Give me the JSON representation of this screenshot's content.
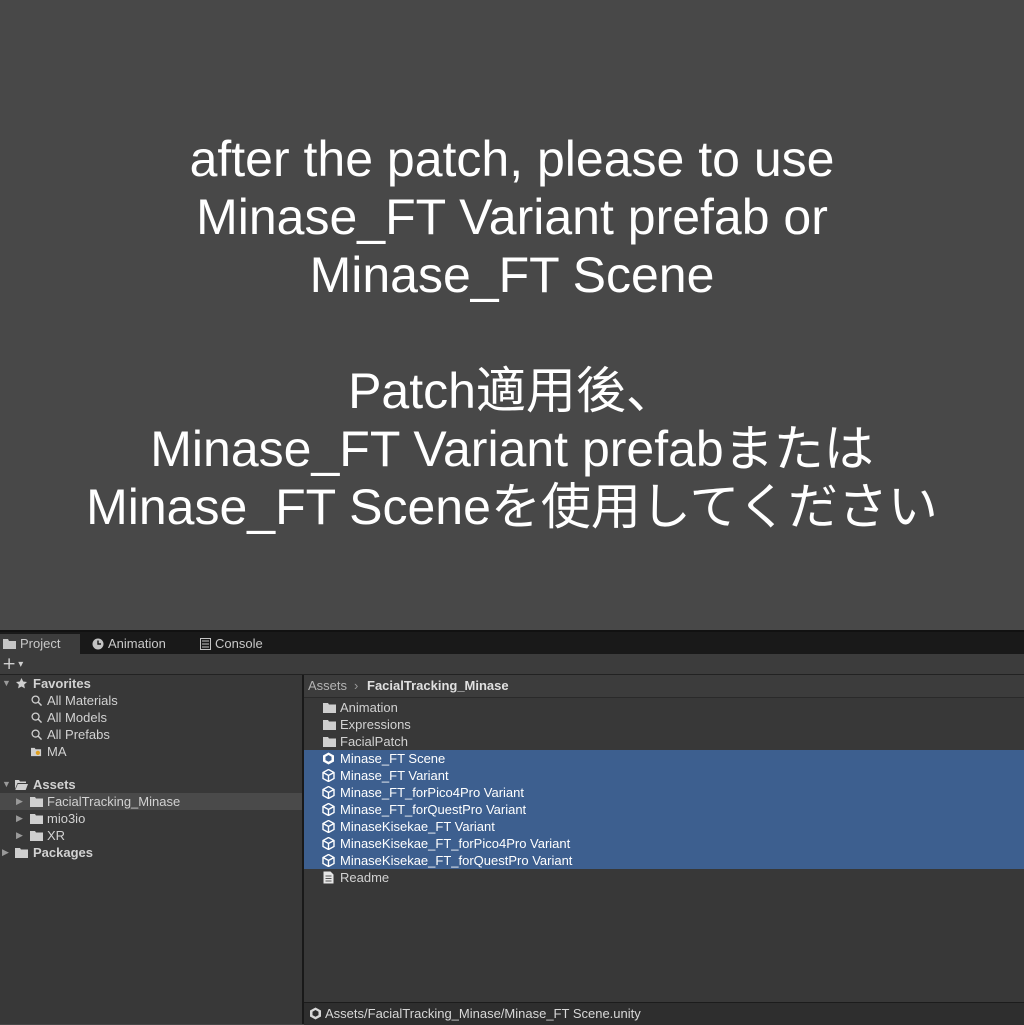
{
  "banner": {
    "line1": "after the patch, please to use",
    "line2": "Minase_FT Variant prefab or",
    "line3": "Minase_FT Scene",
    "line4": "Patch適用後、",
    "line5": "Minase_FT Variant prefabまたは",
    "line6": "Minase_FT Sceneを使用してください"
  },
  "tabs": [
    {
      "label": "Project",
      "icon": "folder-icon"
    },
    {
      "label": "Animation",
      "icon": "clock-icon"
    },
    {
      "label": "Console",
      "icon": "console-icon"
    }
  ],
  "toolbar": {
    "add_label": "+",
    "dropdown_glyph": "▾"
  },
  "sidebar": {
    "favorites": {
      "label": "Favorites",
      "items": [
        "All Materials",
        "All Models",
        "All Prefabs",
        "MA"
      ]
    },
    "assets": {
      "label": "Assets",
      "items": [
        "FacialTracking_Minase",
        "mio3io",
        "XR"
      ]
    },
    "packages": {
      "label": "Packages"
    }
  },
  "breadcrumb": {
    "root": "Assets",
    "separator": "›",
    "current": "FacialTracking_Minase"
  },
  "files": [
    {
      "name": "Animation",
      "type": "folder"
    },
    {
      "name": "Expressions",
      "type": "folder"
    },
    {
      "name": "FacialPatch",
      "type": "folder"
    },
    {
      "name": "Minase_FT Scene",
      "type": "scene"
    },
    {
      "name": "Minase_FT Variant",
      "type": "prefab"
    },
    {
      "name": "Minase_FT_forPico4Pro Variant",
      "type": "prefab"
    },
    {
      "name": "Minase_FT_forQuestPro Variant",
      "type": "prefab"
    },
    {
      "name": "MinaseKisekae_FT Variant",
      "type": "prefab"
    },
    {
      "name": "MinaseKisekae_FT_forPico4Pro Variant",
      "type": "prefab"
    },
    {
      "name": "MinaseKisekae_FT_forQuestPro Variant",
      "type": "prefab"
    },
    {
      "name": "Readme",
      "type": "text"
    }
  ],
  "status": {
    "path": "Assets/FacialTracking_Minase/Minase_FT Scene.unity"
  },
  "colors": {
    "background": "#484848",
    "editor": "#383838",
    "selection": "#3d5f8f",
    "text": "#ffffff"
  }
}
